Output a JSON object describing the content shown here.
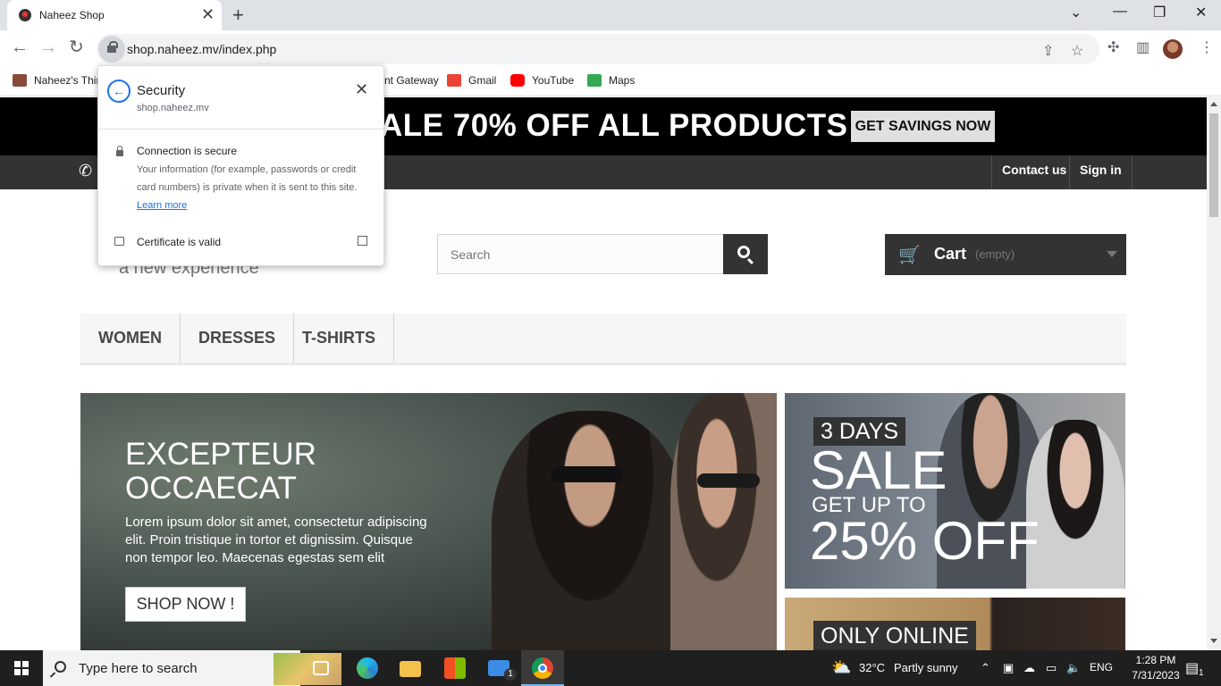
{
  "browser": {
    "tab_title": "Naheez Shop",
    "url": "shop.naheez.mv/index.php",
    "bookmarks": [
      {
        "label": "Naheez's Thir",
        "color": "#8a4a3a"
      },
      {
        "label": "nt Gateway",
        "color": ""
      },
      {
        "label": "Gmail",
        "color": "#ea4335"
      },
      {
        "label": "YouTube",
        "color": "#ff0000"
      },
      {
        "label": "Maps",
        "color": "#34a853"
      }
    ]
  },
  "security_popup": {
    "title": "Security",
    "domain": "shop.naheez.mv",
    "connection_label": "Connection is secure",
    "info_text": "Your information (for example, passwords or credit card numbers) is private when it is sent to this site.",
    "learn_more": "Learn more",
    "certificate_label": "Certificate is valid"
  },
  "page": {
    "promo_text": "ALE 70% OFF ALL PRODUCTS",
    "promo_button": "GET SAVINGS NOW",
    "nav_links": [
      "Contact us",
      "Sign in"
    ],
    "tagline": "a new experience",
    "search_placeholder": "Search",
    "cart_label": "Cart",
    "cart_status": "(empty)",
    "menu": [
      "WOMEN",
      "DRESSES",
      "T-SHIRTS"
    ],
    "slider": {
      "title": "EXCEPTEUR OCCAECAT",
      "text": "Lorem ipsum dolor sit amet, consectetur adipiscing elit. Proin tristique in tortor et dignissim. Quisque non tempor leo. Maecenas egestas sem elit",
      "button": "SHOP NOW !"
    },
    "banner1": {
      "days": "3 DAYS",
      "sale": "SALE",
      "get_up_to": "GET UP TO",
      "percent": "25% OFF"
    },
    "banner2": {
      "label": "ONLY ONLINE"
    }
  },
  "taskbar": {
    "search_placeholder": "Type here to search",
    "weather_temp": "32°C",
    "weather_text": "Partly sunny",
    "language": "ENG",
    "time": "1:28 PM",
    "date": "7/31/2023",
    "mail_badge": "1",
    "notification_badge": "1"
  }
}
